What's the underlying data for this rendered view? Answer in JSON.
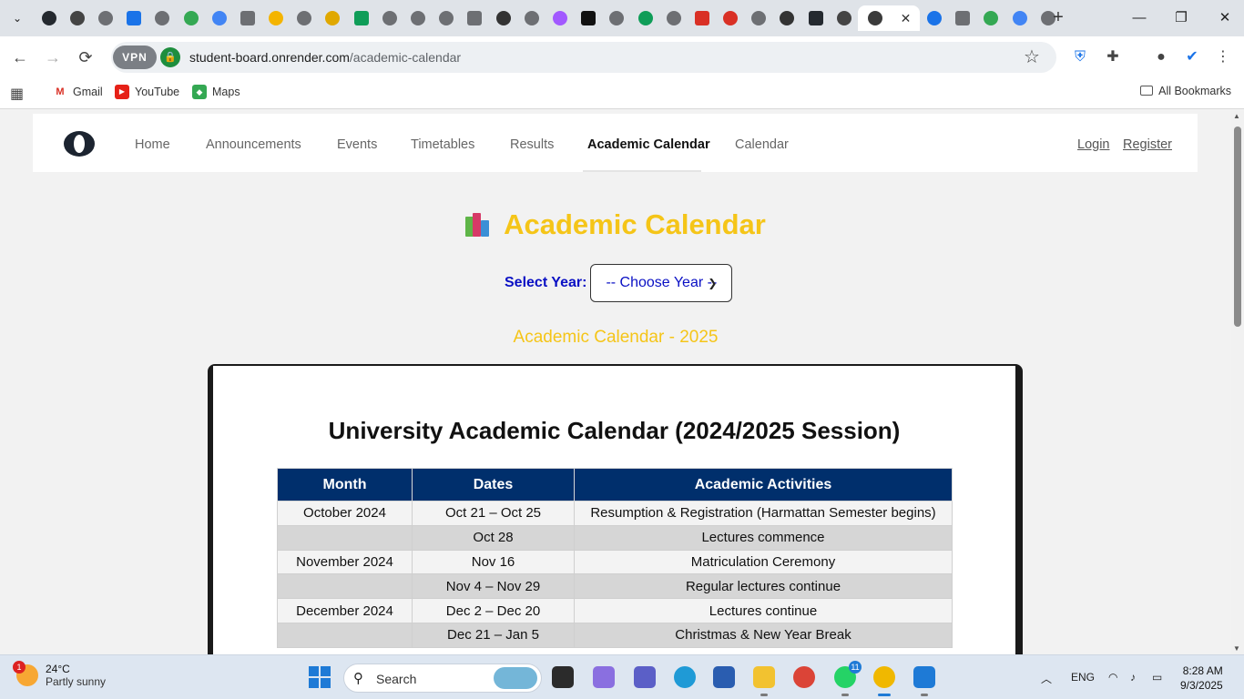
{
  "browser": {
    "tab_count": 36,
    "active_tab_close": "✕",
    "new_tab": "+",
    "window_controls": [
      "—",
      "❐",
      "✕"
    ],
    "back": "←",
    "forward": "→",
    "reload": "⟳",
    "vpn_label": "VPN",
    "url_host": "student-board.onrender.com",
    "url_path": "/academic-calendar",
    "bookmarks": [
      {
        "label": "Gmail",
        "icon": "gmail-icon"
      },
      {
        "label": "YouTube",
        "icon": "youtube-icon"
      },
      {
        "label": "Maps",
        "icon": "maps-icon"
      }
    ],
    "all_bookmarks": "All Bookmarks"
  },
  "site": {
    "nav": [
      {
        "label": "Home",
        "active": false
      },
      {
        "label": "Announcements",
        "active": false
      },
      {
        "label": "Events",
        "active": false
      },
      {
        "label": "Timetables",
        "active": false
      },
      {
        "label": "Results",
        "active": false
      },
      {
        "label": "Academic Calendar",
        "active": true
      },
      {
        "label": "Calendar",
        "active": false
      }
    ],
    "login": "Login",
    "register": "Register",
    "page_title": "Academic Calendar",
    "year_label": "Select Year:",
    "year_placeholder": "-- Choose Year --",
    "calendar_heading": "Academic Calendar - 2025",
    "colors": {
      "title": "#f5c518",
      "year_text": "#0a10c4",
      "table_header": "#002f6c"
    }
  },
  "calendar_doc": {
    "title": "University Academic Calendar (2024/2025 Session)",
    "columns": [
      "Month",
      "Dates",
      "Academic Activities"
    ],
    "rows": [
      [
        "October 2024",
        "Oct 21 – Oct 25",
        "Resumption & Registration (Harmattan Semester begins)"
      ],
      [
        "",
        "Oct 28",
        "Lectures commence"
      ],
      [
        "November 2024",
        "Nov 16",
        "Matriculation Ceremony"
      ],
      [
        "",
        "Nov 4 – Nov 29",
        "Regular lectures continue"
      ],
      [
        "December 2024",
        "Dec 2 – Dec 20",
        "Lectures continue"
      ],
      [
        "",
        "Dec 21 – Jan 5",
        "Christmas & New Year Break"
      ]
    ]
  },
  "taskbar": {
    "weather_temp": "24°C",
    "weather_desc": "Partly sunny",
    "weather_badge": "1",
    "search_label": "Search",
    "whatsapp_badge": "11",
    "lang": "ENG",
    "time": "8:28 AM",
    "date": "9/3/2025"
  }
}
